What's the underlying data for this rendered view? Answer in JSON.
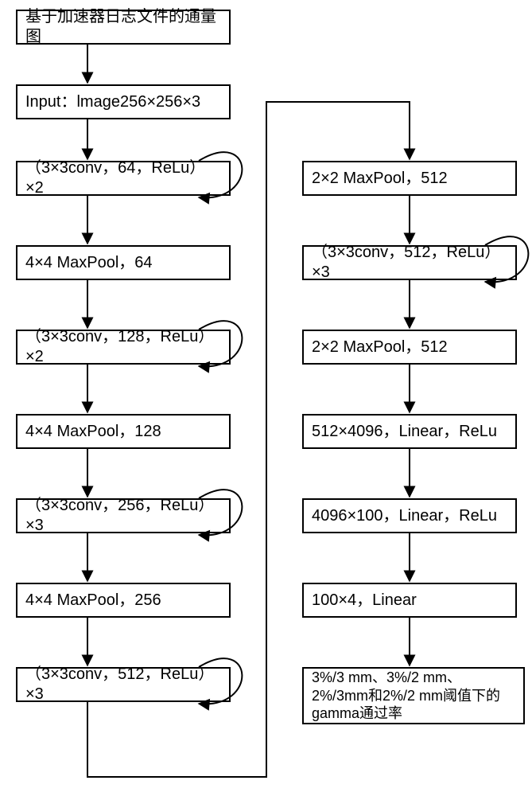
{
  "nodes": {
    "n0": "基于加速器日志文件的通量图",
    "n1": "Input：lmage256×256×3",
    "n2": "（3×3conv，64，ReLu）×2",
    "n3": "4×4 MaxPool，64",
    "n4": "（3×3conv，128，ReLu）×2",
    "n5": "4×4 MaxPool，128",
    "n6": "（3×3conv，256，ReLu）×3",
    "n7": "4×4 MaxPool，256",
    "n8": "（3×3conv，512，ReLu）×3",
    "r1": "2×2 MaxPool，512",
    "r2": "（3×3conv，512，ReLu）×3",
    "r3": "2×2 MaxPool，512",
    "r4": "512×4096，Linear，ReLu",
    "r5": "4096×100，Linear，ReLu",
    "r6": "100×4，Linear",
    "r7": "3%/3 mm、3%/2 mm、2%/3mm和2%/2 mm阈值下的gamma通过率"
  }
}
